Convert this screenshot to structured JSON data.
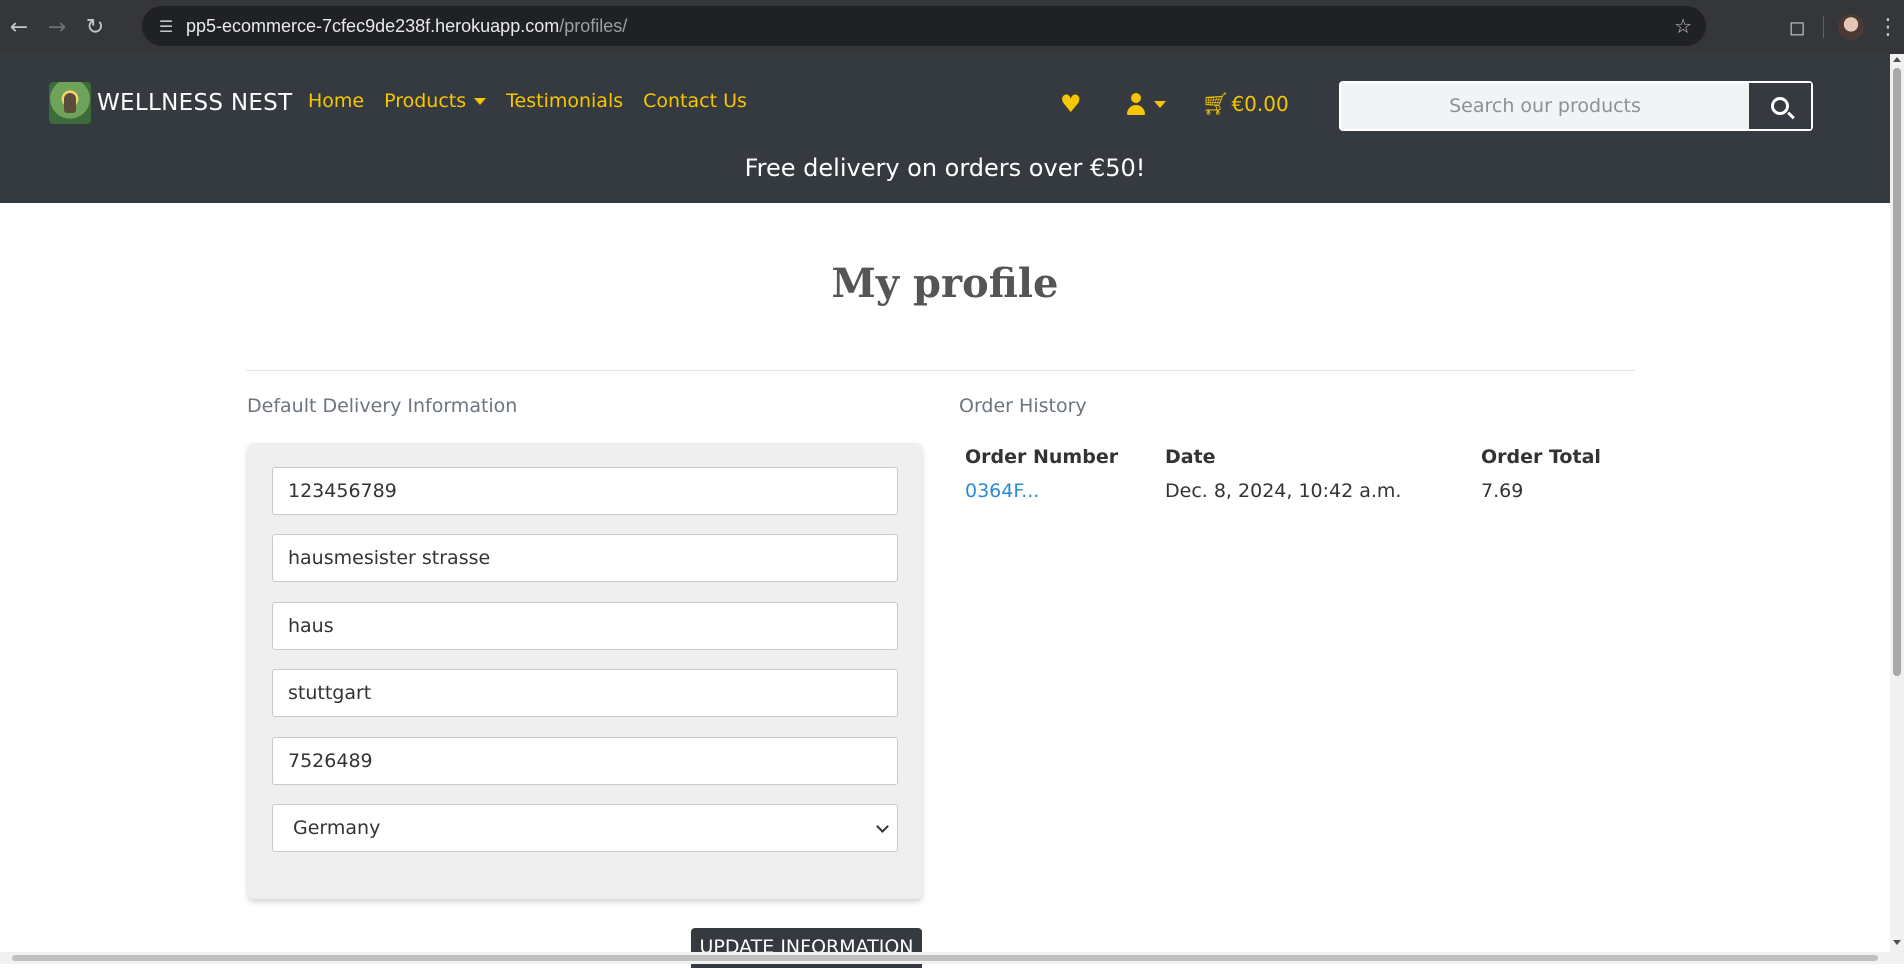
{
  "browser": {
    "url_host": "pp5-ecommerce-7cfec9de238f.herokuapp.com",
    "url_path": "/profiles/"
  },
  "header": {
    "brand": "WELLNESS NEST",
    "nav": [
      "Home",
      "Products",
      "Testimonials",
      "Contact Us"
    ],
    "cart_total": "€0.00",
    "search_placeholder": "Search our products",
    "promo": "Free delivery on orders over €50!"
  },
  "page": {
    "title": "My profile",
    "delivery_label": "Default Delivery Information",
    "order_history_label": "Order History",
    "fields": {
      "phone": "123456789",
      "street1": "hausmesister strasse",
      "street2": "haus",
      "town": "stuttgart",
      "postcode": "7526489",
      "country": "Germany"
    },
    "update_button": "UPDATE INFORMATION",
    "orders_headers": [
      "Order Number",
      "Date",
      "Order Total"
    ],
    "orders": [
      {
        "number": "0364F...",
        "date": "Dec. 8, 2024, 10:42 a.m.",
        "total": "7.69"
      }
    ]
  },
  "colors": {
    "accent": "#f7c600",
    "header_bg": "#343a40",
    "link": "#2b8ad8"
  }
}
